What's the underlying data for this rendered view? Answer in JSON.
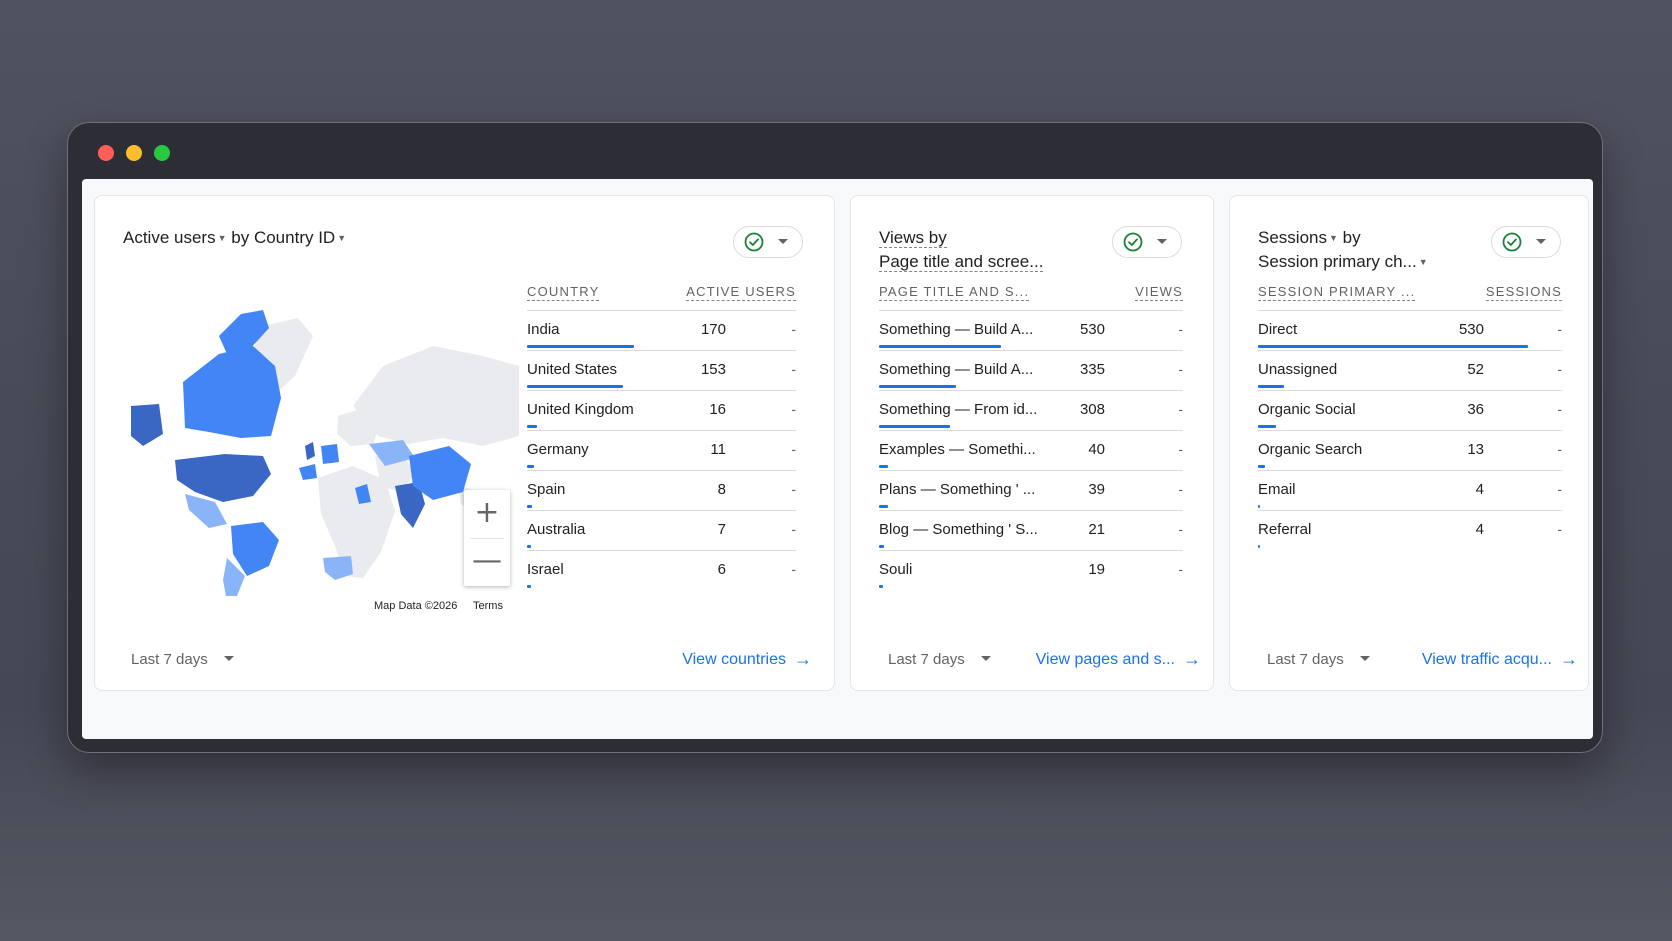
{
  "colors": {
    "accent": "#1a73e8",
    "map_dark": "#3a66c4",
    "map_mid": "#4285f4",
    "map_light": "#8ab4f8",
    "map_empty": "#eceff1",
    "check_green": "#188038"
  },
  "cards": [
    {
      "title": {
        "metric": "Active users",
        "by": "by",
        "dimension": "Country ID"
      },
      "table": {
        "col1": "COUNTRY",
        "col2": "ACTIVE USERS",
        "rows": [
          {
            "label": "India",
            "value": "170",
            "dash": "-",
            "share": 1.0
          },
          {
            "label": "United States",
            "value": "153",
            "dash": "-",
            "share": 0.9
          },
          {
            "label": "United Kingdom",
            "value": "16",
            "dash": "-",
            "share": 0.09
          },
          {
            "label": "Germany",
            "value": "11",
            "dash": "-",
            "share": 0.065
          },
          {
            "label": "Spain",
            "value": "8",
            "dash": "-",
            "share": 0.047
          },
          {
            "label": "Australia",
            "value": "7",
            "dash": "-",
            "share": 0.041
          },
          {
            "label": "Israel",
            "value": "6",
            "dash": "-",
            "share": 0.035
          }
        ]
      },
      "map": {
        "credit": "Map Data ©2026",
        "terms": "Terms",
        "zoom_in": "+",
        "zoom_out": "—"
      },
      "footer": {
        "date_range": "Last 7 days",
        "link": "View countries"
      }
    },
    {
      "title": {
        "line1": "Views by",
        "line2": "Page title and scree..."
      },
      "table": {
        "col1": "PAGE TITLE AND S...",
        "col2": "VIEWS",
        "rows": [
          {
            "label": "Something — Build A...",
            "value": "530",
            "dash": "-",
            "share": 1.0
          },
          {
            "label": "Something — Build A...",
            "value": "335",
            "dash": "-",
            "share": 0.63
          },
          {
            "label": "Something — From id...",
            "value": "308",
            "dash": "-",
            "share": 0.58
          },
          {
            "label": "Examples — Somethi...",
            "value": "40",
            "dash": "-",
            "share": 0.075
          },
          {
            "label": "Plans — Something ' ...",
            "value": "39",
            "dash": "-",
            "share": 0.074
          },
          {
            "label": "Blog — Something ' S...",
            "value": "21",
            "dash": "-",
            "share": 0.04
          },
          {
            "label": "Souli",
            "value": "19",
            "dash": "-",
            "share": 0.036
          }
        ]
      },
      "footer": {
        "date_range": "Last 7 days",
        "link": "View pages and s..."
      }
    },
    {
      "title": {
        "metric": "Sessions",
        "by": "by",
        "dimension": "Session primary ch..."
      },
      "table": {
        "col1": "SESSION PRIMARY ...",
        "col2": "SESSIONS",
        "rows": [
          {
            "label": "Direct",
            "value": "530",
            "dash": "-",
            "share": 1.0
          },
          {
            "label": "Unassigned",
            "value": "52",
            "dash": "-",
            "share": 0.098
          },
          {
            "label": "Organic Social",
            "value": "36",
            "dash": "-",
            "share": 0.068
          },
          {
            "label": "Organic Search",
            "value": "13",
            "dash": "-",
            "share": 0.025
          },
          {
            "label": "Email",
            "value": "4",
            "dash": "-",
            "share": 0.008
          },
          {
            "label": "Referral",
            "value": "4",
            "dash": "-",
            "share": 0.008
          }
        ]
      },
      "footer": {
        "date_range": "Last 7 days",
        "link": "View traffic acqu..."
      }
    }
  ]
}
